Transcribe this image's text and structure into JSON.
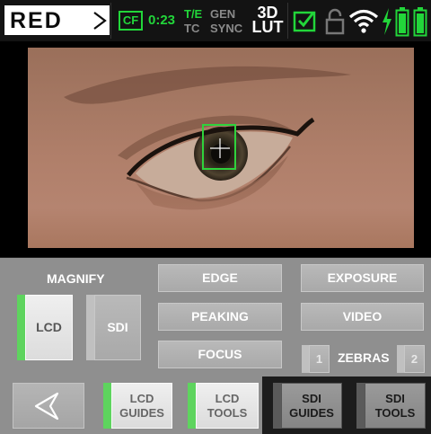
{
  "status_bar": {
    "logo": "RED",
    "media_badge": "CF",
    "record_time": "0:23",
    "te_label": "T/E",
    "gen_label": "GEN",
    "tc_label": "TC",
    "sync_label": "SYNC",
    "lut_top": "3D",
    "lut_bottom": "LUT",
    "icons": [
      "media-check-icon",
      "lock-icon",
      "wifi-icon",
      "charging-bolt-icon",
      "battery-icon",
      "battery-icon"
    ],
    "colors": {
      "active": "#22d63a",
      "inactive": "#8a8a8a"
    }
  },
  "magnify": {
    "title": "MAGNIFY",
    "lcd_label": "LCD",
    "lcd_active": true,
    "sdi_label": "SDI",
    "sdi_active": false
  },
  "tools": {
    "edge": "EDGE",
    "peaking": "PEAKING",
    "focus": "FOCUS",
    "exposure": "EXPOSURE",
    "video": "VIDEO",
    "zebras": "ZEBRAS",
    "zebra_1": "1",
    "zebra_2": "2"
  },
  "footer": {
    "back_icon": "back-arrow-icon",
    "lcd_guides_1": "LCD",
    "lcd_guides_2": "GUIDES",
    "lcd_tools_1": "LCD",
    "lcd_tools_2": "TOOLS",
    "sdi_guides_1": "SDI",
    "sdi_guides_2": "GUIDES",
    "sdi_tools_1": "SDI",
    "sdi_tools_2": "TOOLS"
  }
}
